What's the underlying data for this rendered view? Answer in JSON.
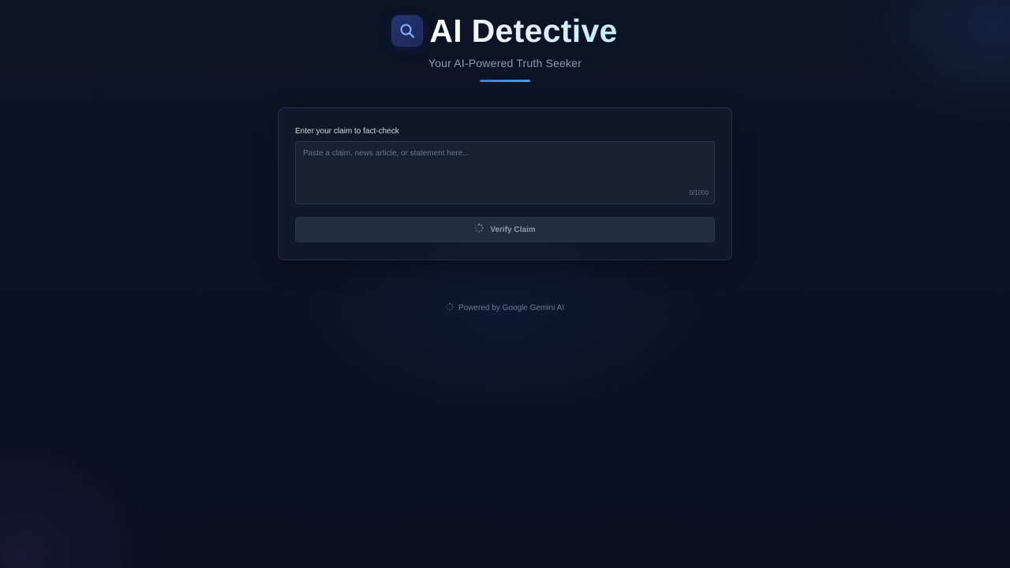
{
  "header": {
    "title": "AI Detective",
    "subtitle": "Your AI-Powered Truth Seeker",
    "logo_icon": "search-icon"
  },
  "form": {
    "label": "Enter your claim to fact-check",
    "claim_input": {
      "value": "",
      "placeholder": "Paste a claim, news article, or statement here..."
    },
    "char_count": "0/1000",
    "verify_button": {
      "label": "Verify Claim",
      "icon": "loading-spinner-icon"
    }
  },
  "footer": {
    "text": "Powered by Google Gemini AI",
    "icon": "spinner-icon"
  },
  "colors": {
    "background": "#0b1226",
    "accent": "#3b82d6",
    "card": "#161e30",
    "input": "#172132",
    "button": "#222d41"
  }
}
